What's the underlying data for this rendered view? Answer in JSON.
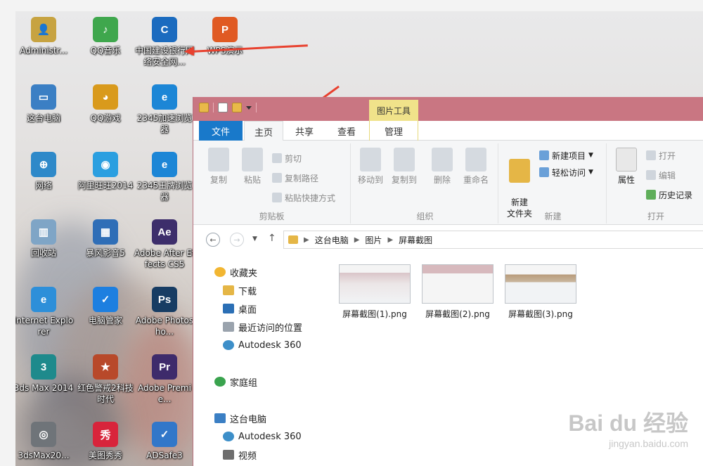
{
  "desktop": {
    "icons": [
      {
        "label": "Administr...",
        "glyph": "👤",
        "color": "#c7a341"
      },
      {
        "label": "QQ音乐",
        "glyph": "♪",
        "color": "#3fa74d"
      },
      {
        "label": "中国建设银行网络安全网...",
        "glyph": "C",
        "color": "#1b6bbf"
      },
      {
        "label": "WPS演示",
        "glyph": "P",
        "color": "#e05a23"
      },
      {
        "label": "这台电脑",
        "glyph": "▭",
        "color": "#3b7fc4"
      },
      {
        "label": "QQ游戏",
        "glyph": "◕",
        "color": "#d99a1c"
      },
      {
        "label": "2345加速浏览器",
        "glyph": "e",
        "color": "#1c86d6"
      },
      {
        "label": "网络",
        "glyph": "⊕",
        "color": "#2e89c9"
      },
      {
        "label": "阿里旺旺2014",
        "glyph": "◉",
        "color": "#2b9fe0"
      },
      {
        "label": "2345王牌浏览器",
        "glyph": "e",
        "color": "#1c86d6"
      },
      {
        "label": "回收站",
        "glyph": "▥",
        "color": "#7fa5c6"
      },
      {
        "label": "暴风影音5",
        "glyph": "▦",
        "color": "#2f6eb7"
      },
      {
        "label": "Adobe After Effects CS5",
        "glyph": "Ae",
        "color": "#3d2e6b"
      },
      {
        "label": "Internet Explorer",
        "glyph": "e",
        "color": "#2d8fd9"
      },
      {
        "label": "电脑管家",
        "glyph": "✓",
        "color": "#1d7fe0"
      },
      {
        "label": "Adobe Photosho...",
        "glyph": "Ps",
        "color": "#173c63"
      },
      {
        "label": "3ds Max 2014",
        "glyph": "3",
        "color": "#1e8a8c"
      },
      {
        "label": "红色警戒2科技时代",
        "glyph": "★",
        "color": "#b8492a"
      },
      {
        "label": "Adobe Premie...",
        "glyph": "Pr",
        "color": "#3e2b6b"
      },
      {
        "label": "3dsMax20...",
        "glyph": "◎",
        "color": "#6f7479"
      },
      {
        "label": "美图秀秀",
        "glyph": "秀",
        "color": "#d8243b"
      },
      {
        "label": "ADSafe3",
        "glyph": "✓",
        "color": "#3277c9"
      }
    ]
  },
  "explorer": {
    "context_tab": "图片工具",
    "tabs": [
      "文件",
      "主页",
      "共享",
      "查看",
      "管理"
    ],
    "ribbon": {
      "clipboard": {
        "title": "剪贴板",
        "copy": "复制",
        "paste": "粘贴",
        "cut": "剪切",
        "copy_path": "复制路径",
        "paste_shortcut": "粘贴快捷方式"
      },
      "organize": {
        "title": "组织",
        "move_to": "移动到",
        "copy_to": "复制到",
        "delete": "删除",
        "rename": "重命名"
      },
      "new": {
        "title": "新建",
        "new_folder": "新建\n文件夹",
        "new_item": "新建项目",
        "easy_access": "轻松访问"
      },
      "open": {
        "title": "打开",
        "properties": "属性",
        "open": "打开",
        "edit": "编辑",
        "history": "历史记录"
      }
    },
    "address": {
      "parts": [
        "这台电脑",
        "图片",
        "屏幕截图"
      ]
    },
    "nav": {
      "favorites": "收藏夹",
      "downloads": "下载",
      "desktop": "桌面",
      "recent": "最近访问的位置",
      "autodesk": "Autodesk 360",
      "homegroup": "家庭组",
      "this_pc": "这台电脑",
      "autodesk2": "Autodesk 360",
      "videos": "视频"
    },
    "files": [
      "屏幕截图(1).png",
      "屏幕截图(2).png",
      "屏幕截图(3).png"
    ]
  },
  "watermark": {
    "line1": "Bai du 经验",
    "line2": "jingyan.baidu.com"
  },
  "colors": {
    "titlebar": "#c97682",
    "file_tab": "#1979ca",
    "context_tab": "#f0e28a",
    "arrow": "#e8412f"
  }
}
